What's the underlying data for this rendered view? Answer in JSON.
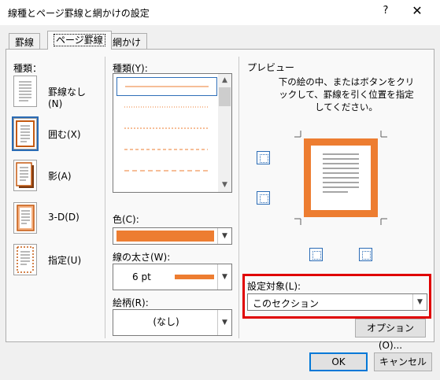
{
  "window": {
    "title": "線種とページ罫線と網かけの設定",
    "help": "?",
    "close": "✕"
  },
  "tabs": [
    {
      "label": "罫線",
      "active": false
    },
    {
      "label": "ページ罫線",
      "active": true
    },
    {
      "label": "網かけ",
      "active": false
    }
  ],
  "settings": {
    "label": "種類：",
    "items": [
      {
        "label": "罫線なし(N)",
        "icon": "no-border-icon",
        "selected": false
      },
      {
        "label": "囲む(X)",
        "icon": "box-border-icon",
        "selected": true
      },
      {
        "label": "影(A)",
        "icon": "shadow-border-icon",
        "selected": false
      },
      {
        "label": "3-D(D)",
        "icon": "3d-border-icon",
        "selected": false
      },
      {
        "label": "指定(U)",
        "icon": "custom-border-icon",
        "selected": false
      }
    ]
  },
  "style": {
    "label": "種類(Y):",
    "selected_index": 0
  },
  "color": {
    "label": "色(C):",
    "value_color": "#ed7d31"
  },
  "width": {
    "label": "線の太さ(W):",
    "value": "6 pt"
  },
  "art": {
    "label": "絵柄(R):",
    "value": "(なし)"
  },
  "preview": {
    "label": "プレビュー",
    "description": "下の絵の中、またはボタンをクリックして、罫線を引く位置を指定してください。",
    "border_color": "#ed7d31"
  },
  "apply_to": {
    "label": "設定対象(L):",
    "value": "このセクション",
    "highlight_color": "#e00000"
  },
  "buttons": {
    "options": "オプション(O)...",
    "ok": "OK",
    "cancel": "キャンセル"
  }
}
